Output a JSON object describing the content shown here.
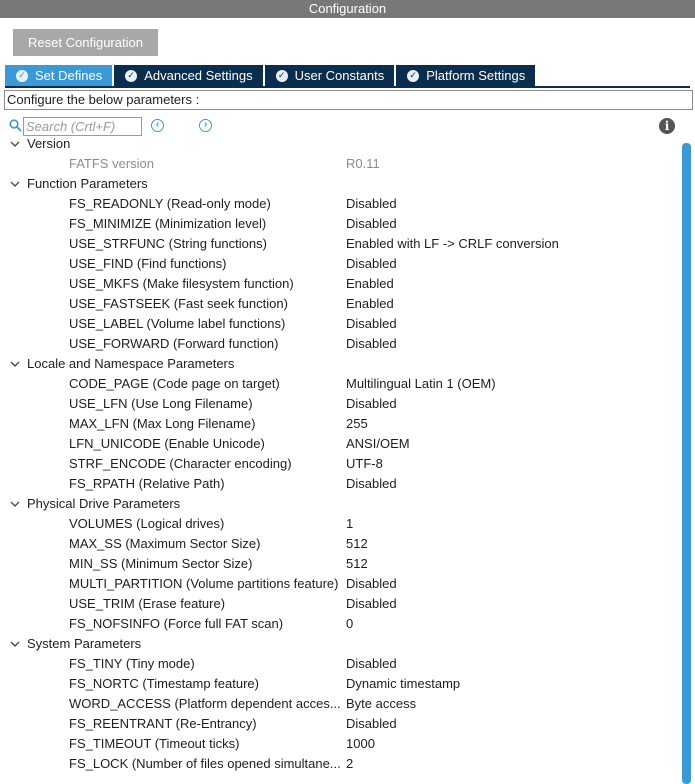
{
  "window": {
    "title": "Configuration"
  },
  "toolbar": {
    "reset_label": "Reset Configuration"
  },
  "tabs": [
    {
      "label": "Set Defines",
      "active": true
    },
    {
      "label": "Advanced Settings",
      "active": false
    },
    {
      "label": "User Constants",
      "active": false
    },
    {
      "label": "Platform Settings",
      "active": false
    }
  ],
  "hint": "Configure the below parameters :",
  "search": {
    "placeholder": "Search (Crtl+F)",
    "value": ""
  },
  "icons": {
    "search": "search-icon",
    "prev": "chevron-left-circle-icon",
    "next": "chevron-right-circle-icon",
    "info": "info-icon",
    "tab_check": "check-circle-icon",
    "expand": "chevron-down-icon"
  },
  "colors": {
    "accent": "#3b9ad6",
    "tab_dark": "#0b2e4f",
    "title_bar": "#787878",
    "button_gray": "#a8a8a8"
  },
  "groups": [
    {
      "label": "Version",
      "params": [
        {
          "name": "FATFS version",
          "value": "R0.11",
          "readonly": true
        }
      ]
    },
    {
      "label": "Function Parameters",
      "params": [
        {
          "name": "FS_READONLY (Read-only mode)",
          "value": "Disabled"
        },
        {
          "name": "FS_MINIMIZE (Minimization level)",
          "value": "Disabled"
        },
        {
          "name": "USE_STRFUNC (String functions)",
          "value": "Enabled with LF -> CRLF conversion"
        },
        {
          "name": "USE_FIND (Find functions)",
          "value": "Disabled"
        },
        {
          "name": "USE_MKFS (Make filesystem function)",
          "value": "Enabled"
        },
        {
          "name": "USE_FASTSEEK (Fast seek function)",
          "value": "Enabled"
        },
        {
          "name": "USE_LABEL (Volume label functions)",
          "value": "Disabled"
        },
        {
          "name": "USE_FORWARD (Forward function)",
          "value": "Disabled"
        }
      ]
    },
    {
      "label": "Locale and Namespace Parameters",
      "params": [
        {
          "name": "CODE_PAGE (Code page on target)",
          "value": "Multilingual Latin 1 (OEM)"
        },
        {
          "name": "USE_LFN (Use Long Filename)",
          "value": "Disabled"
        },
        {
          "name": "MAX_LFN (Max Long Filename)",
          "value": "255"
        },
        {
          "name": "LFN_UNICODE (Enable Unicode)",
          "value": "ANSI/OEM"
        },
        {
          "name": "STRF_ENCODE (Character encoding)",
          "value": "UTF-8"
        },
        {
          "name": "FS_RPATH (Relative Path)",
          "value": "Disabled"
        }
      ]
    },
    {
      "label": "Physical Drive Parameters",
      "params": [
        {
          "name": "VOLUMES (Logical drives)",
          "value": "1"
        },
        {
          "name": "MAX_SS (Maximum Sector Size)",
          "value": "512"
        },
        {
          "name": "MIN_SS (Minimum Sector Size)",
          "value": "512"
        },
        {
          "name": "MULTI_PARTITION (Volume partitions feature)",
          "value": "Disabled"
        },
        {
          "name": "USE_TRIM (Erase feature)",
          "value": "Disabled"
        },
        {
          "name": "FS_NOFSINFO (Force full FAT scan)",
          "value": "0"
        }
      ]
    },
    {
      "label": "System Parameters",
      "params": [
        {
          "name": "FS_TINY (Tiny mode)",
          "value": "Disabled"
        },
        {
          "name": "FS_NORTC (Timestamp feature)",
          "value": "Dynamic timestamp"
        },
        {
          "name": "WORD_ACCESS (Platform dependent acces...",
          "value": "Byte access"
        },
        {
          "name": "FS_REENTRANT (Re-Entrancy)",
          "value": "Disabled"
        },
        {
          "name": "FS_TIMEOUT (Timeout ticks)",
          "value": "1000"
        },
        {
          "name": "FS_LOCK (Number of files opened simultane...",
          "value": "2"
        }
      ]
    }
  ]
}
